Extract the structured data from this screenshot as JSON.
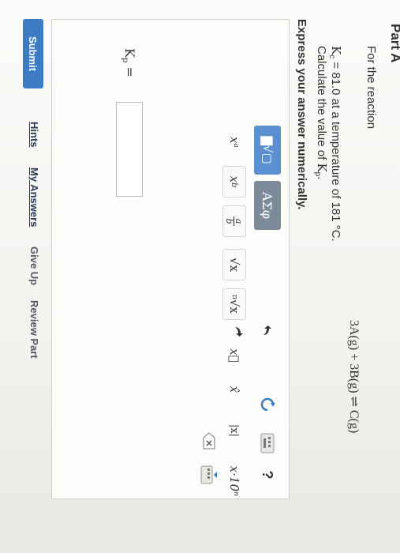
{
  "part": {
    "title": "Part A"
  },
  "question": {
    "intro": "For the reaction",
    "equation": "3A(g) + 3B(g) ⇌ C(g)",
    "kc_symbol": "K",
    "kc_sub": "c",
    "kc_rest": " = 81.0 at a temperature of 181 °C.",
    "calc_prefix": "Calculate the value of ",
    "kp_symbol": "K",
    "kp_sub": "p",
    "calc_suffix": ".",
    "instruction": "Express your answer numerically."
  },
  "toolbar": {
    "templates_label": "▇√▢",
    "greek_label": "ΑΣφ"
  },
  "templates": {
    "power": "xᵃ",
    "subscript": "x_b",
    "fraction_top": "a",
    "fraction_bottom": "b",
    "sqrt": "√x",
    "nroot_index": "n",
    "nroot": "√x",
    "vector": "x⃗",
    "hat": "x̂",
    "abs": "|x|",
    "sci_notation": "x·10ⁿ"
  },
  "tools": {
    "help": "?"
  },
  "answer": {
    "label_symbol": "K",
    "label_sub": "p",
    "label_eq": " =",
    "value": ""
  },
  "actions": {
    "submit": "Submit",
    "hints": "Hints",
    "my_answers": "My Answers",
    "give_up": "Give Up",
    "review_part": "Review Part"
  },
  "colors": {
    "templates_button": "#5a8fd0",
    "greek_button": "#7d8a99",
    "submit_button": "#3d7cc2"
  }
}
